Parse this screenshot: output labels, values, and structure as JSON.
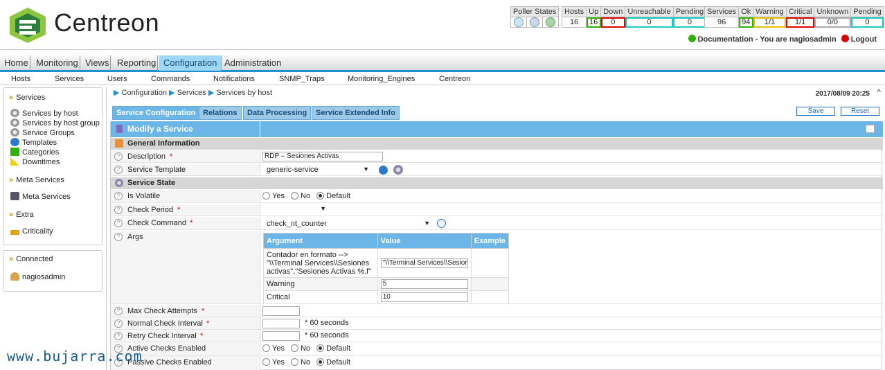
{
  "brand": {
    "name": "Centreon"
  },
  "status": {
    "poller_title": "Poller States",
    "hosts": {
      "headers": [
        "Hosts",
        "Up",
        "Down",
        "Unreachable",
        "Pending"
      ],
      "values": [
        "16",
        "16",
        "0",
        "0",
        "0"
      ]
    },
    "services": {
      "headers": [
        "Services",
        "Ok",
        "Warning",
        "Critical",
        "Unknown",
        "Pending"
      ],
      "values": [
        "96",
        "94",
        "1/1",
        "1/1",
        "0/0",
        "0"
      ]
    }
  },
  "userline": {
    "documentation": "Documentation",
    "sep": " - You are nagiosadmin",
    "logout": "Logout"
  },
  "main_menu": [
    "Home",
    "Monitoring",
    "Views",
    "Reporting",
    "Configuration",
    "Administration"
  ],
  "sub_menu": [
    "Hosts",
    "Services",
    "Users",
    "Commands",
    "Notifications",
    "SNMP_Traps",
    "Monitoring_Engines",
    "Centreon"
  ],
  "sidebar": {
    "services_title": "Services",
    "services_items": [
      "Services by host",
      "Services by host group",
      "Service Groups",
      "Templates",
      "Categories",
      "Downtimes"
    ],
    "meta_title": "Meta Services",
    "meta_items": [
      "Meta Services"
    ],
    "extra_title": "Extra",
    "extra_items": [
      "Criticality"
    ],
    "connected_title": "Connected",
    "connected_user": "nagiosadmin"
  },
  "breadcrumb": [
    "Configuration",
    "Services",
    "Services by host"
  ],
  "datetime": "2017/08/09 20:25",
  "tabs": [
    "Service Configuration",
    "Relations",
    "Data Processing",
    "Service Extended Info"
  ],
  "buttons": {
    "save": "Save",
    "reset": "Reset"
  },
  "form": {
    "title": "Modify a Service",
    "general_section": "General Information",
    "description_label": "Description",
    "description_value": "RDP – Sesiones Activas",
    "template_label": "Service Template",
    "template_value": "generic-service",
    "state_section": "Service State",
    "volatile_label": "Is Volatile",
    "radio_yes": "Yes",
    "radio_no": "No",
    "radio_default": "Default",
    "check_period_label": "Check Period",
    "check_period_value": "",
    "check_command_label": "Check Command",
    "check_command_value": "check_nt_counter",
    "args_label": "Args",
    "args_headers": [
      "Argument",
      "Value",
      "Example"
    ],
    "args_rows": [
      {
        "argument": "Contador en formato --> \"\\\\Terminal Services\\\\Sesiones activas\",\"Sesiones Activas %.f\"",
        "value": "\"\\\\Terminal Services\\\\Sesion"
      },
      {
        "argument": "Warning",
        "value": "5"
      },
      {
        "argument": "Critical",
        "value": "10"
      }
    ],
    "max_attempts_label": "Max Check Attempts",
    "normal_interval_label": "Normal Check Interval",
    "retry_interval_label": "Retry Check Interval",
    "seconds_suffix": "* 60 seconds",
    "active_checks_label": "Active Checks Enabled",
    "passive_checks_label": "Passive Checks Enabled"
  },
  "watermark": "www.bujarra.com"
}
